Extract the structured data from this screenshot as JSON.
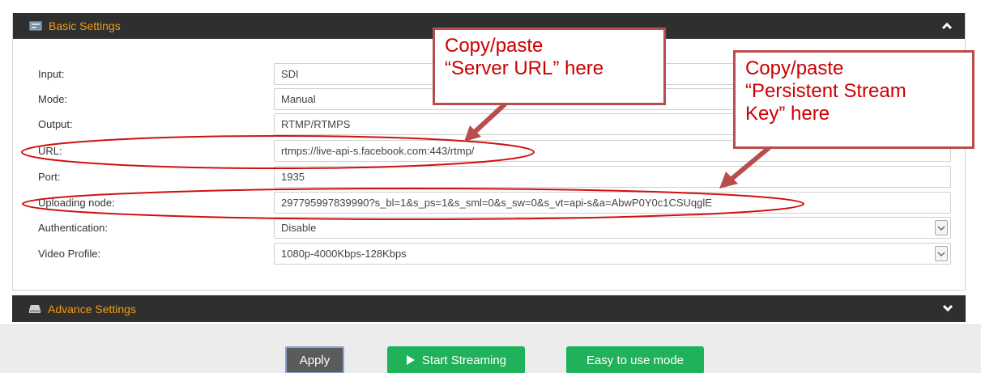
{
  "basic_settings": {
    "title": "Basic Settings",
    "rows": [
      {
        "label": "Input:",
        "value": "SDI"
      },
      {
        "label": "Mode:",
        "value": "Manual"
      },
      {
        "label": "Output:",
        "value": "RTMP/RTMPS"
      },
      {
        "label": "URL:",
        "value": "rtmps://live-api-s.facebook.com:443/rtmp/"
      },
      {
        "label": "Port:",
        "value": "1935"
      },
      {
        "label": "Uploading node:",
        "value": "297795997839990?s_bl=1&s_ps=1&s_sml=0&s_sw=0&s_vt=api-s&a=AbwP0Y0c1CSUqglE"
      },
      {
        "label": "Authentication:",
        "value": "Disable"
      },
      {
        "label": "Video Profile:",
        "value": "1080p-4000Kbps-128Kbps"
      }
    ]
  },
  "advance_settings": {
    "title": "Advance Settings"
  },
  "footer": {
    "apply_label": "Apply",
    "start_label": "Start Streaming",
    "easy_label": "Easy to use mode"
  },
  "callouts": {
    "server_url": [
      "Copy/paste",
      "“Server URL” here"
    ],
    "stream_key": [
      "Copy/paste",
      "“Persistent Stream",
      "Key” here"
    ]
  },
  "colors": {
    "header_bg": "#2f2f2f",
    "header_text": "#f39c12",
    "button_green": "#1fb25a",
    "annotation_red": "#cc0000"
  },
  "icons": {
    "basic_settings": "settings-panel-icon",
    "advance_settings": "drive-icon",
    "collapse": "chevron-up-icon",
    "expand": "chevron-down-icon",
    "start": "play-icon"
  }
}
